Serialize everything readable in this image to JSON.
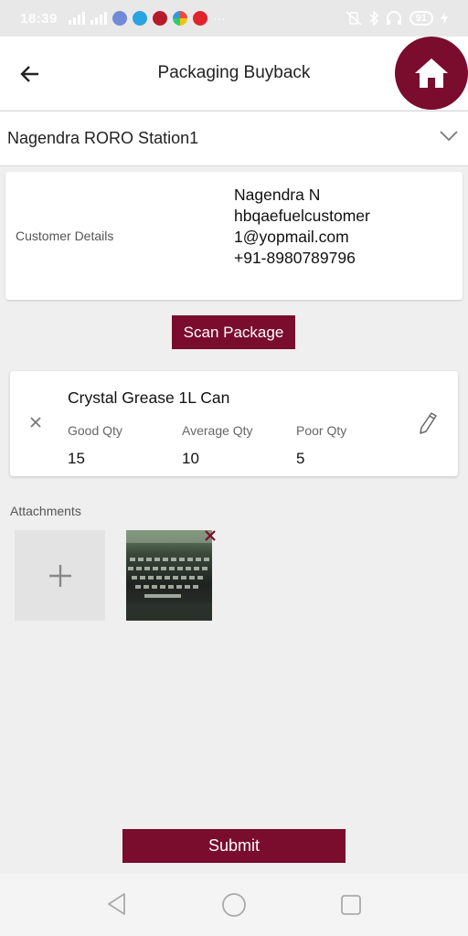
{
  "status_bar": {
    "time": "18:39",
    "battery": "91",
    "icons": [
      "signal-icon",
      "discord-icon",
      "telegram-icon",
      "app-icon",
      "pinwheel-icon",
      "opera-icon",
      "more-icon",
      "vibrate-icon",
      "bluetooth-icon",
      "headset-icon",
      "battery-icon",
      "charging-icon"
    ]
  },
  "header": {
    "title": "Packaging Buyback",
    "back_icon": "arrow-left-icon",
    "home_icon": "home-icon"
  },
  "station": {
    "value": "Nagendra RORO Station1",
    "icon": "chevron-down-icon"
  },
  "customer": {
    "label": "Customer Details",
    "name": "Nagendra N",
    "email": "hbqaefuelcustomer1@yopmail.com",
    "phone": "+91-8980789796"
  },
  "scan_button": "Scan Package",
  "package": {
    "name": "Crystal Grease 1L Can",
    "good_label": "Good Qty",
    "good_value": "15",
    "average_label": "Average Qty",
    "average_value": "10",
    "poor_label": "Poor Qty",
    "poor_value": "5"
  },
  "attachments": {
    "label": "Attachments"
  },
  "submit_button": "Submit",
  "colors": {
    "primary": "#7a0c2e",
    "background": "#efefef"
  }
}
